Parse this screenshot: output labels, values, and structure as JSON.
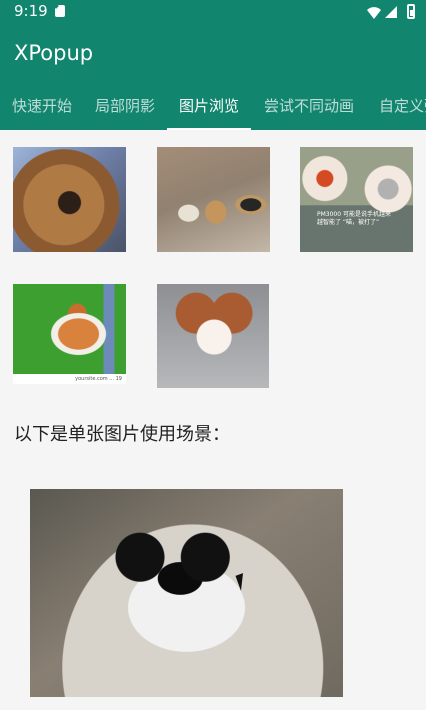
{
  "status": {
    "time": "9:19"
  },
  "app": {
    "title": "XPopup"
  },
  "tabs": [
    {
      "label": "快速开始"
    },
    {
      "label": "局部阴影"
    },
    {
      "label": "图片浏览"
    },
    {
      "label": "尝试不同动画"
    },
    {
      "label": "自定义弹"
    }
  ],
  "content": {
    "single_image_label": "以下是单张图片使用场景：",
    "thumb_text": "PM3000\n可能是说手机越来越智能了\n“喵，被打了”",
    "caption_text": "yoursite.com ... 19"
  },
  "colors": {
    "accent": "#12856f",
    "background": "#f5f5f5",
    "text": "#222222"
  },
  "icons": {
    "storage": "sd-card-icon",
    "wifi": "wifi-icon",
    "signal": "signal-icon",
    "battery": "battery-icon",
    "cursor": "mouse-cursor-icon"
  }
}
